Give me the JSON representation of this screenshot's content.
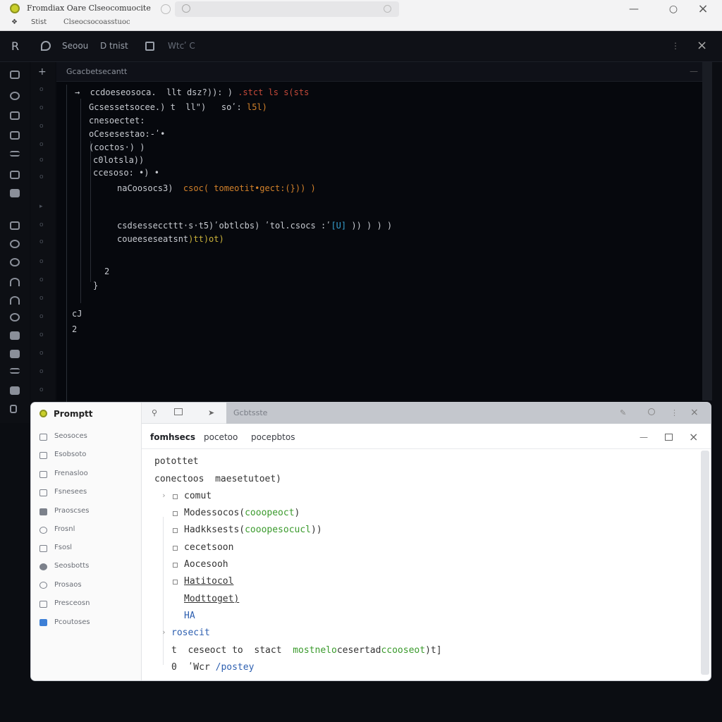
{
  "window": {
    "title": "Fromdiax Oare Clseocomuocite",
    "sub_labels": [
      "❖",
      "Stist",
      "Clseocsocoasstuoc"
    ]
  },
  "ide": {
    "toolbar": {
      "left_icon": "R",
      "items": [
        "Seoou",
        "D tnist",
        "Wtcʹ C"
      ],
      "right_dots": "⋮",
      "close": "×"
    },
    "tab_name": "Gcacbetsecantt",
    "code_lines": [
      {
        "text": "→  ccdoeseosoca.  llt dsz?)): ) ",
        "tail": ".stct ls s(sts",
        "tail_color": "red"
      },
      {
        "text": "Gcsessetsocee.) t  ll\")   soʹ: ",
        "tail": "l5l)",
        "tail_color": "orange"
      },
      {
        "text": "cnesoectet:"
      },
      {
        "text": "oCesesestao:-ʹ•"
      },
      {
        "text": "(coctos·) )"
      },
      {
        "text": "c0lotsla))"
      },
      {
        "text": "ccesoso: •) •"
      },
      {
        "text": "naCoosocs3)  ",
        "tail": "csoc( tomeotit•gect:(})) )",
        "tail_color": "orange"
      },
      {
        "text": "csdsesseccttt·s·t5)ʹobtlcbs) ʹtol.csocs :ʹ",
        "tail": "[U]",
        "tail_color": "cyan",
        "rest": " )) ) ) )"
      },
      {
        "text": "coueeseseatsnt",
        "tail": ")tt)ot)",
        "tail_color": "yellow"
      },
      {
        "text": "2"
      },
      {
        "text": "}"
      },
      {
        "text": "cJ"
      },
      {
        "text": "2"
      }
    ]
  },
  "prompt_window": {
    "title": "Promptt",
    "tab_label": "Gcbtsste",
    "sidebar": [
      {
        "label": "Seosoces"
      },
      {
        "label": "Esobsoto"
      },
      {
        "label": "Frenasloo"
      },
      {
        "label": "Fsnesees"
      },
      {
        "label": "Praoscses"
      },
      {
        "label": "Frosnl"
      },
      {
        "label": "Fsosl"
      },
      {
        "label": "Seosbotts"
      },
      {
        "label": "Prosaos"
      },
      {
        "label": "Presceosn"
      },
      {
        "label": "Pcoutoses"
      }
    ],
    "menu": [
      "fomhsecs",
      "pocetoo",
      "pocepbtos"
    ],
    "lines": {
      "l1": "potottet",
      "l2": "conectoos  maesetutoet)",
      "l3": "comut",
      "l4a": "Modessocos(",
      "l4b": "cooopeoct",
      "l4c": ")",
      "l5a": "Hadkksests(",
      "l5b": "cooopesocucl",
      "l5c": "))",
      "l6": "cecetsoon",
      "l7": "Aocesooh",
      "l8": "Hatitocol",
      "l9": "Modttoget)",
      "l10": "HA",
      "l11": "rosecit",
      "l12a": "t  ceseoct to  stact  ",
      "l12b": "mostnelo",
      "l12c": "cesertad",
      "l12d": "ccooseot",
      "l12e": ")t]",
      "l13a": "0  ",
      "l13b": "ʹWcr",
      "l13c": " /postey"
    }
  },
  "colors": {
    "accent": "#c9cf2a",
    "editor_bg": "#06080d",
    "prompt_bg": "#ffffff"
  }
}
